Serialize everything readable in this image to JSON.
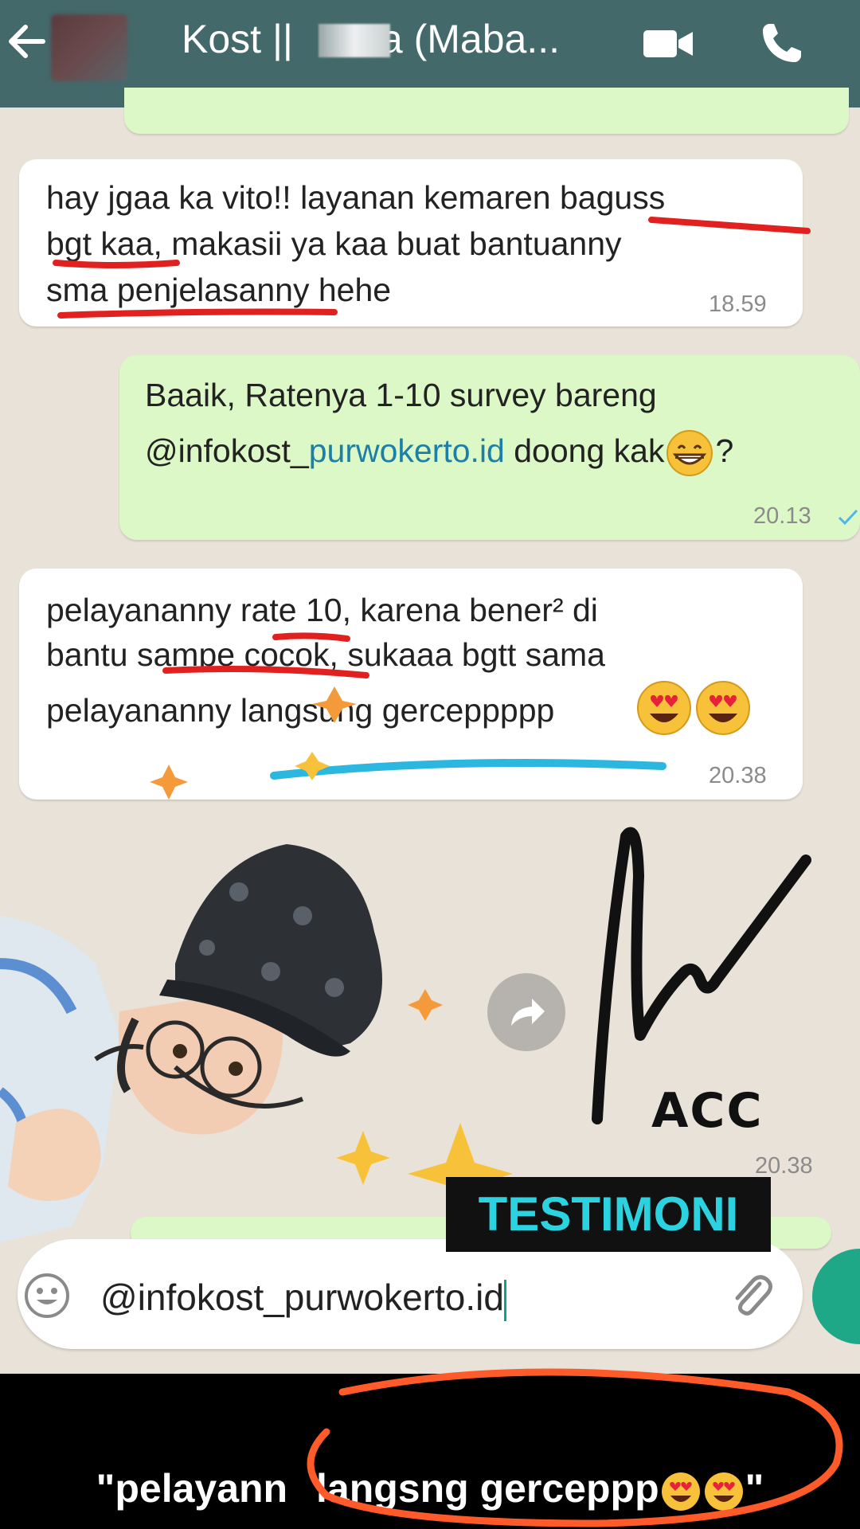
{
  "header": {
    "title": "Kost ||",
    "title_suffix": "a (Maba...",
    "back_icon": "back-arrow-icon",
    "video_icon": "video-camera-icon",
    "call_icon": "phone-icon"
  },
  "messages": [
    {
      "direction": "in",
      "lines": [
        "hay jgaa ka vito!! layanan kemaren baguss",
        "bgt kaa, makasii ya kaa buat bantuanny",
        "sma penjelasanny hehe"
      ],
      "time": "18.59"
    },
    {
      "direction": "out",
      "line1": "Baaik, Ratenya 1-10 survey bareng",
      "line2_prefix": "@infokost_",
      "line2_link": "purwokerto.id",
      "line2_suffix": " doong kak",
      "line2_end": "?",
      "time": "20.13"
    },
    {
      "direction": "in",
      "lines": [
        "pelayananny rate 10, karena bener² di",
        "bantu sampe cocok, sukaaa bgtt sama",
        "pelayananny langsung gerceppppp"
      ],
      "time": "20.38"
    }
  ],
  "sticker": {
    "annotation_text": "ACC",
    "time": "20.38"
  },
  "testimoni_label": "TESTIMONI",
  "composer": {
    "value": "@infokost_purwokerto.id",
    "emoji_icon": "smiley-icon",
    "attach_icon": "paperclip-icon"
  },
  "caption": {
    "text_before": "\"pelayann",
    "text_after": " langsng gerceppp",
    "text_end": "\""
  },
  "colors": {
    "header": "#43696a",
    "chat_bg": "#e9e2d8",
    "outgoing": "#dcf8c6",
    "link": "#1b7fa8",
    "underline_red": "#e0211f",
    "underline_blue": "#2bb7e0",
    "testimoni_text": "#2bd3e0",
    "circle_orange": "#ff5a2a"
  }
}
